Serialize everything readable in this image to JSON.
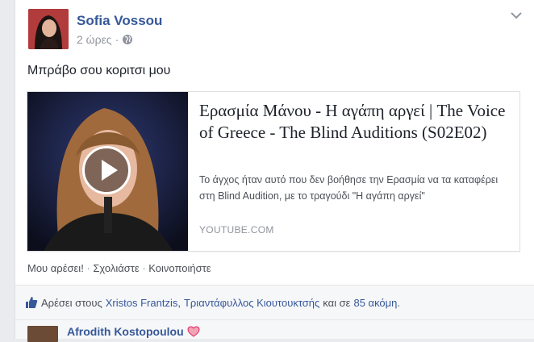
{
  "post": {
    "author": "Sofia Vossou",
    "time": "2 ώρες",
    "separator": "·",
    "privacy_icon": "globe-icon",
    "menu_icon": "chevron-down-icon",
    "text": "Μπράβο σου κοριτσι μου"
  },
  "link_preview": {
    "title": "Ερασμία Μάνου - Η αγάπη αργεί | The Voice of Greece - The Blind Auditions (S02E02)",
    "description": "Το άγχος ήταν αυτό που δεν βοήθησε την Ερασμία να τα καταφέρει στη Blind Audition, με το τραγούδι \"Η αγάπη αργεί\"",
    "domain": "YOUTUBE.COM",
    "play_icon": "play-icon"
  },
  "actions": {
    "like": "Μου αρέσει!",
    "comment": "Σχολιάστε",
    "share": "Κοινοποιήστε",
    "sep": " · "
  },
  "likes": {
    "icon": "thumbs-up-icon",
    "prefix": "Αρέσει στους",
    "person1": "Xristos Frantzis",
    "comma": ",",
    "person2": "Τριαντάφυλλος Κιουτουκτσής",
    "and": "και σε",
    "others": "85 ακόμη",
    "period": "."
  },
  "comment": {
    "author": "Afrodith Kostopoulou",
    "emoji": "heart-icon"
  },
  "colors": {
    "link_blue": "#365899",
    "text": "#1d2129",
    "secondary": "#90949c",
    "heart": "#e0245e"
  }
}
